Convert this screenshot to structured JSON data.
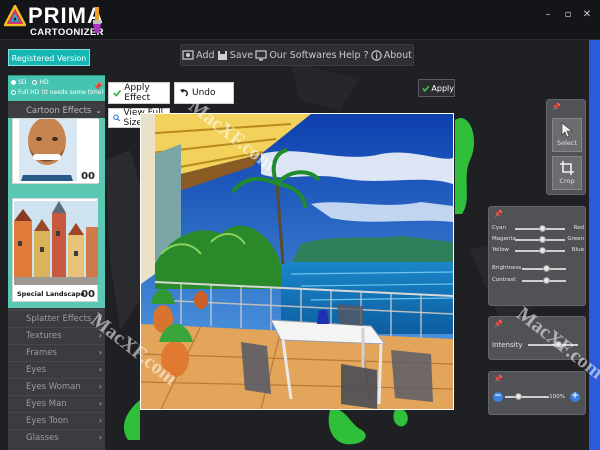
{
  "app": {
    "logo_main": "PRIMA",
    "logo_sub": "CARTOONIZER",
    "registered": "Registered Version",
    "window_controls": [
      "minimize-icon",
      "maximize-icon",
      "close-icon"
    ]
  },
  "menu": {
    "items": [
      {
        "label": "Add",
        "icon": "add-photo-icon"
      },
      {
        "label": "Save",
        "icon": "save-icon"
      },
      {
        "label": "Our Softwares",
        "icon": "software-icon"
      },
      {
        "label": "Help ?",
        "icon": "help-icon"
      },
      {
        "label": "About",
        "icon": "info-icon"
      }
    ]
  },
  "resolution": {
    "sd": "SD",
    "hd": "HD",
    "fullhd": "Full HD (It needs some time)"
  },
  "left_panel": {
    "header": "Cartoon Effects",
    "thumbs": [
      {
        "label": "",
        "count": "00"
      },
      {
        "label": "Special Landscape",
        "count": "00"
      }
    ],
    "categories": [
      "Splatter Effects",
      "Textures",
      "Frames",
      "Eyes",
      "Eyes Woman",
      "Eyes Man",
      "Eyes Toon",
      "Glasses"
    ]
  },
  "actions": {
    "apply_effect": "Apply Effect",
    "undo": "Undo",
    "view_full_size": "View Full Size",
    "apply": "Apply"
  },
  "tools": {
    "select": "Select",
    "crop": "Crop"
  },
  "color_panel": {
    "rows": [
      {
        "left": "Cyan",
        "right": "Red",
        "value": 0.55
      },
      {
        "left": "Magenta",
        "right": "Green",
        "value": 0.55
      },
      {
        "left": "Yellow",
        "right": "Blue",
        "value": 0.55
      }
    ],
    "brightness": {
      "label": "Brightness",
      "value": 0.55
    },
    "contrast": {
      "label": "Contrast",
      "value": 0.55
    }
  },
  "intensity": {
    "label": "Intensity",
    "value": 0.6
  },
  "zoom": {
    "value_text": "100%",
    "value": 0.3
  },
  "watermark": "MacXF.com",
  "colors": {
    "accent": "#16b6b4",
    "panel_teal": "#5bc8b4",
    "background": "#1f2024"
  }
}
